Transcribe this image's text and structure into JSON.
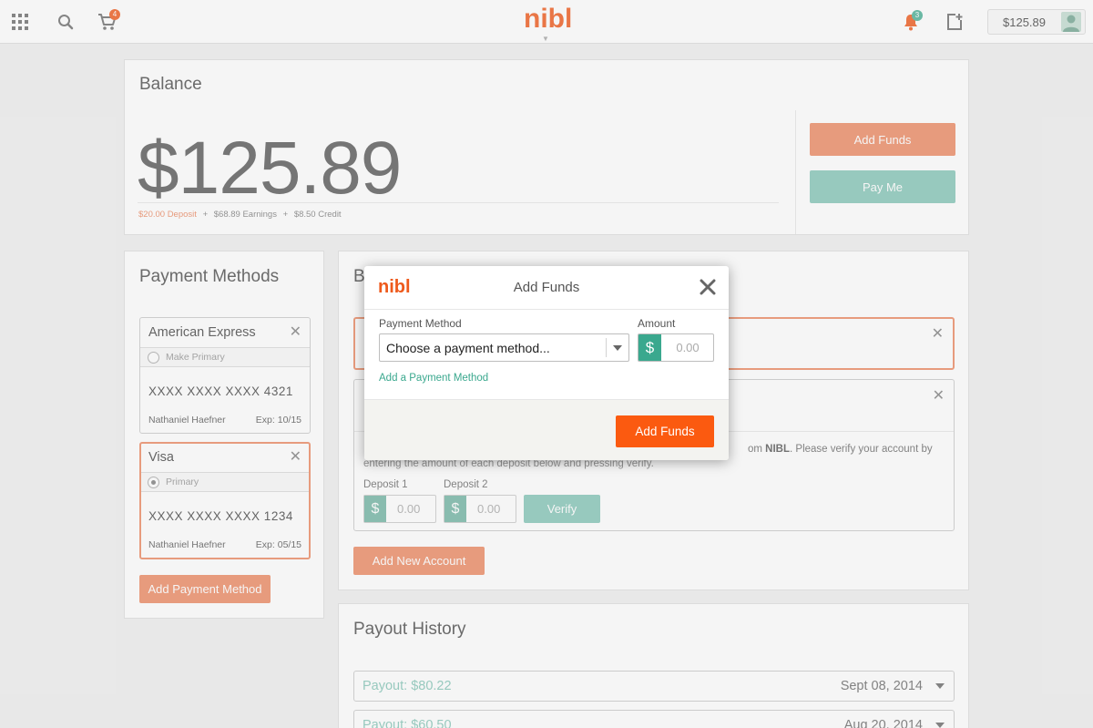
{
  "topbar": {
    "brand": "nibl",
    "cart_count": "4",
    "notification_count": "3",
    "balance": "$125.89",
    "accent": "#f37b49"
  },
  "balance_card": {
    "title": "Balance",
    "amount": "$125.89",
    "breakdown": {
      "deposit": "$20.00 Deposit",
      "earnings": "$68.89 Earnings",
      "credit": "$8.50 Credit",
      "separator": "+"
    },
    "add_funds_label": "Add Funds",
    "pay_me_label": "Pay Me"
  },
  "payment_methods": {
    "title": "Payment Methods",
    "items": [
      {
        "name": "American Express",
        "radio_label": "Make Primary",
        "number": "XXXX XXXX XXXX 4321",
        "holder": "Nathaniel Haefner",
        "exp": "Exp: 10/15",
        "primary": false
      },
      {
        "name": "Visa",
        "radio_label": "Primary",
        "number": "XXXX XXXX XXXX 1234",
        "holder": "Nathaniel Haefner",
        "exp": "Exp: 05/15",
        "primary": true
      }
    ],
    "add_label": "Add Payment Method"
  },
  "bank_accounts": {
    "title_visible": "B",
    "verify_text_prefix": "om ",
    "verify_text_bold": "NIBL",
    "verify_text_suffix": ". Please verify your account by",
    "verify_text_line2": "entering the amount of each deposit below and pressing verify.",
    "deposit1_label": "Deposit 1",
    "deposit2_label": "Deposit 2",
    "currency": "$",
    "deposit_placeholder": "0.00",
    "verify_label": "Verify",
    "add_account_label": "Add New Account"
  },
  "payout_history": {
    "title": "Payout History",
    "rows": [
      {
        "amount": "Payout: $80.22",
        "date": "Sept 08, 2014"
      },
      {
        "amount": "Payout: $60.50",
        "date": "Aug 20, 2014"
      }
    ]
  },
  "modal": {
    "logo": "nibl",
    "title": "Add Funds",
    "payment_method_label": "Payment Method",
    "payment_method_value": "Choose a payment method...",
    "amount_label": "Amount",
    "currency": "$",
    "amount_placeholder": "0.00",
    "add_payment_method_link": "Add a Payment Method",
    "submit_label": "Add Funds"
  }
}
